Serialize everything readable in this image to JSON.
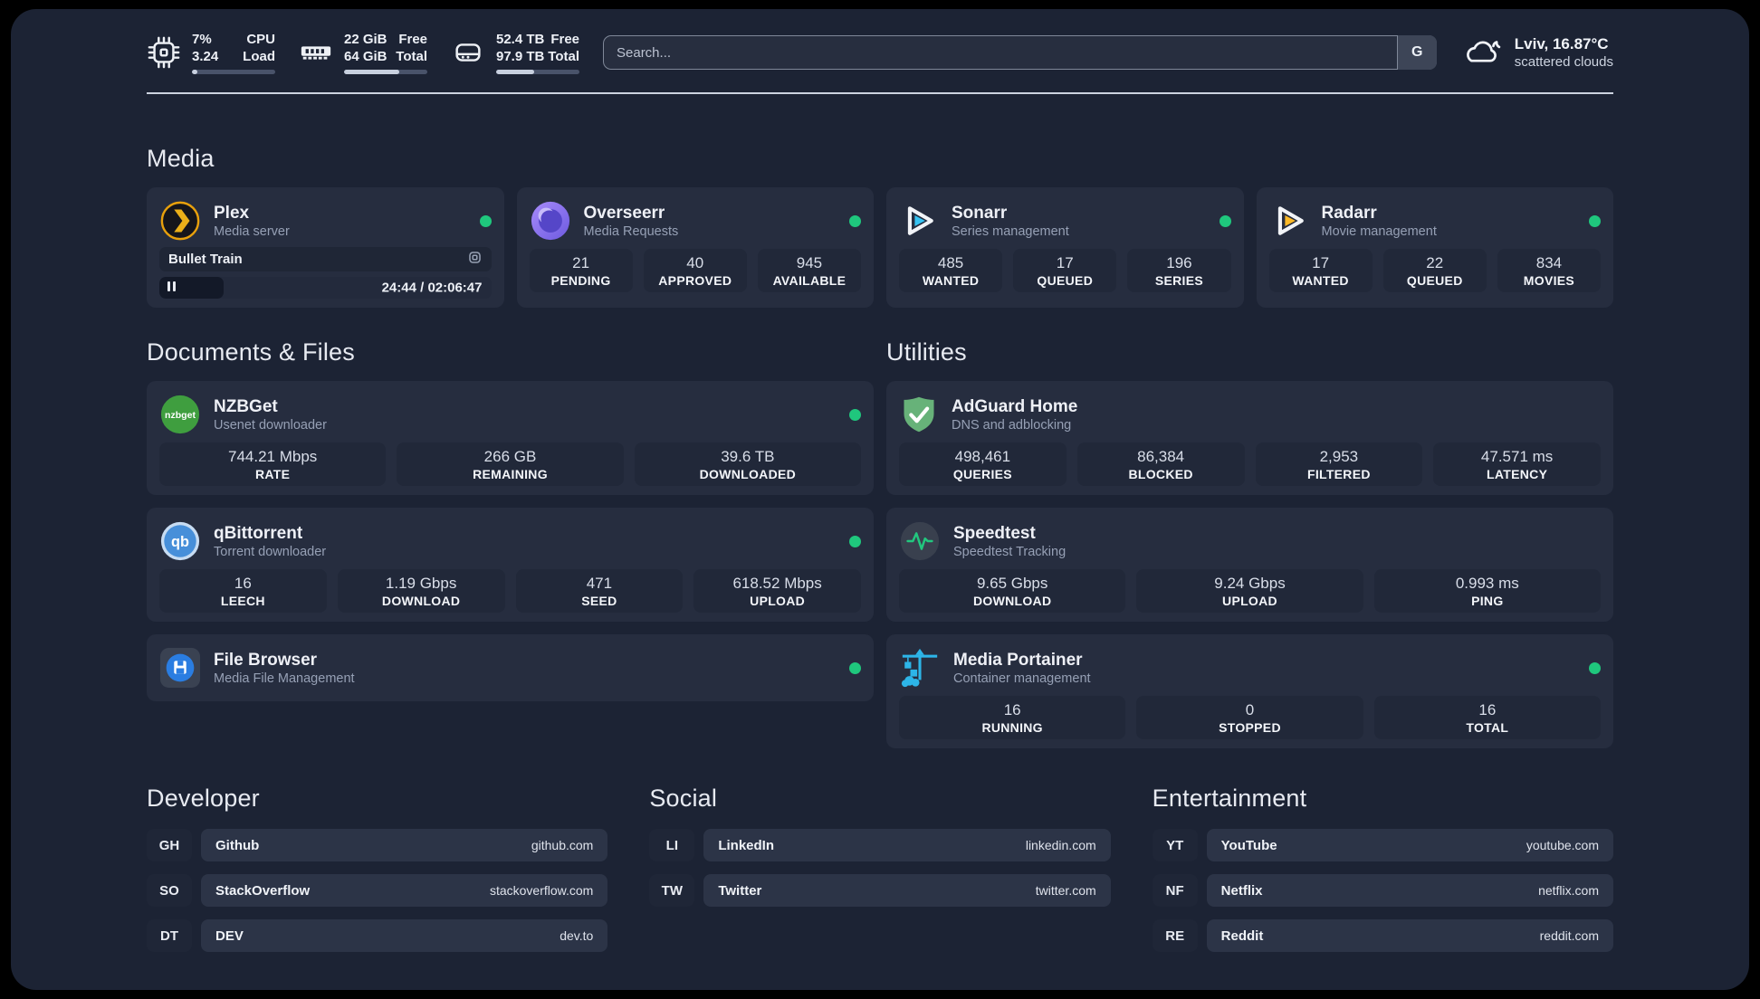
{
  "colors": {
    "status_green": "#1fc77d",
    "accent_plex": "#e8a00c",
    "accent_sonarr": "#36c3f2",
    "accent_radarr": "#fdb927"
  },
  "topbar": {
    "system": [
      {
        "icon": "cpu-icon",
        "values": [
          "7%",
          "3.24"
        ],
        "labels": [
          "CPU",
          "Load"
        ],
        "progress": 7
      },
      {
        "icon": "ram-icon",
        "values": [
          "22 GiB",
          "64 GiB"
        ],
        "labels": [
          "Free",
          "Total"
        ],
        "progress": 66
      },
      {
        "icon": "disk-icon",
        "values": [
          "52.4 TB",
          "97.9 TB"
        ],
        "labels": [
          "Free",
          "Total"
        ],
        "progress": 46
      }
    ],
    "search": {
      "placeholder": "Search...",
      "engine": "G"
    },
    "weather": {
      "line1": "Lviv, 16.87°C",
      "line2": "scattered clouds"
    }
  },
  "sections": {
    "media": {
      "title": "Media",
      "apps": [
        {
          "name": "Plex",
          "subtitle": "Media server",
          "online": true,
          "now_playing": "Bullet Train",
          "time": "24:44 / 02:06:47",
          "progress_pct": 19.5
        },
        {
          "name": "Overseerr",
          "subtitle": "Media Requests",
          "online": true,
          "stats": [
            {
              "v": "21",
              "l": "PENDING"
            },
            {
              "v": "40",
              "l": "APPROVED"
            },
            {
              "v": "945",
              "l": "AVAILABLE"
            }
          ]
        },
        {
          "name": "Sonarr",
          "subtitle": "Series management",
          "online": true,
          "stats": [
            {
              "v": "485",
              "l": "WANTED"
            },
            {
              "v": "17",
              "l": "QUEUED"
            },
            {
              "v": "196",
              "l": "SERIES"
            }
          ]
        },
        {
          "name": "Radarr",
          "subtitle": "Movie management",
          "online": true,
          "stats": [
            {
              "v": "17",
              "l": "WANTED"
            },
            {
              "v": "22",
              "l": "QUEUED"
            },
            {
              "v": "834",
              "l": "MOVIES"
            }
          ]
        }
      ]
    },
    "documents": {
      "title": "Documents & Files",
      "apps": [
        {
          "name": "NZBGet",
          "subtitle": "Usenet downloader",
          "online": true,
          "stats": [
            {
              "v": "744.21 Mbps",
              "l": "RATE"
            },
            {
              "v": "266 GB",
              "l": "REMAINING"
            },
            {
              "v": "39.6 TB",
              "l": "DOWNLOADED"
            }
          ]
        },
        {
          "name": "qBittorrent",
          "subtitle": "Torrent downloader",
          "online": true,
          "stats": [
            {
              "v": "16",
              "l": "LEECH"
            },
            {
              "v": "1.19 Gbps",
              "l": "DOWNLOAD"
            },
            {
              "v": "471",
              "l": "SEED"
            },
            {
              "v": "618.52 Mbps",
              "l": "UPLOAD"
            }
          ]
        },
        {
          "name": "File Browser",
          "subtitle": "Media File Management",
          "online": true,
          "stats": []
        }
      ]
    },
    "utilities": {
      "title": "Utilities",
      "apps": [
        {
          "name": "AdGuard Home",
          "subtitle": "DNS and adblocking",
          "online": false,
          "stats": [
            {
              "v": "498,461",
              "l": "QUERIES"
            },
            {
              "v": "86,384",
              "l": "BLOCKED"
            },
            {
              "v": "2,953",
              "l": "FILTERED"
            },
            {
              "v": "47.571 ms",
              "l": "LATENCY"
            }
          ]
        },
        {
          "name": "Speedtest",
          "subtitle": "Speedtest Tracking",
          "online": false,
          "stats": [
            {
              "v": "9.65 Gbps",
              "l": "DOWNLOAD"
            },
            {
              "v": "9.24 Gbps",
              "l": "UPLOAD"
            },
            {
              "v": "0.993 ms",
              "l": "PING"
            }
          ]
        },
        {
          "name": "Media Portainer",
          "subtitle": "Container management",
          "online": true,
          "stats": [
            {
              "v": "16",
              "l": "RUNNING"
            },
            {
              "v": "0",
              "l": "STOPPED"
            },
            {
              "v": "16",
              "l": "TOTAL"
            }
          ]
        }
      ]
    }
  },
  "links": [
    {
      "title": "Developer",
      "items": [
        {
          "abbr": "GH",
          "name": "Github",
          "url": "github.com"
        },
        {
          "abbr": "SO",
          "name": "StackOverflow",
          "url": "stackoverflow.com"
        },
        {
          "abbr": "DT",
          "name": "DEV",
          "url": "dev.to"
        }
      ]
    },
    {
      "title": "Social",
      "items": [
        {
          "abbr": "LI",
          "name": "LinkedIn",
          "url": "linkedin.com"
        },
        {
          "abbr": "TW",
          "name": "Twitter",
          "url": "twitter.com"
        }
      ]
    },
    {
      "title": "Entertainment",
      "items": [
        {
          "abbr": "YT",
          "name": "YouTube",
          "url": "youtube.com"
        },
        {
          "abbr": "NF",
          "name": "Netflix",
          "url": "netflix.com"
        },
        {
          "abbr": "RE",
          "name": "Reddit",
          "url": "reddit.com"
        }
      ]
    }
  ]
}
